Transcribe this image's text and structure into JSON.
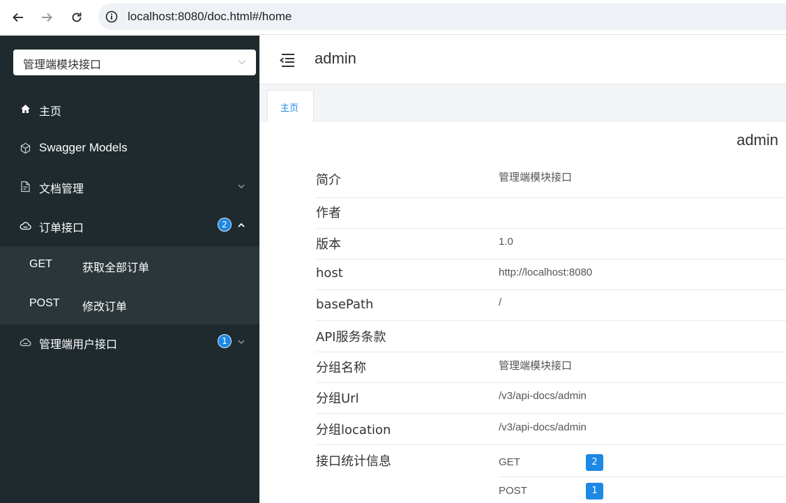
{
  "browser": {
    "url": "localhost:8080/doc.html#/home",
    "icons": [
      "back-arrow-icon",
      "forward-arrow-icon",
      "reload-icon",
      "info-icon"
    ]
  },
  "sidebar": {
    "group_select": "管理端模块接口",
    "items": [
      {
        "label": "主页",
        "icon": "home-icon"
      },
      {
        "label": "Swagger Models",
        "icon": "cube-icon"
      },
      {
        "label": "文档管理",
        "icon": "document-icon"
      },
      {
        "label": "订单接口",
        "icon": "cloud-icon",
        "badge": "2",
        "expanded": true
      },
      {
        "label": "管理端用户接口",
        "icon": "cloud-icon",
        "badge": "1",
        "expanded": false
      }
    ],
    "submenu": [
      {
        "method": "GET",
        "label": "获取全部订单"
      },
      {
        "method": "POST",
        "label": "修改订单"
      }
    ]
  },
  "main": {
    "title": "admin",
    "tab": "主页",
    "doc_title": "admin",
    "info": [
      {
        "label": "简介",
        "value": "管理端模块接口"
      },
      {
        "label": "作者",
        "value": ""
      },
      {
        "label": "版本",
        "value": "1.0"
      },
      {
        "label": "host",
        "value": "http://localhost:8080"
      },
      {
        "label": "basePath",
        "value": "/"
      },
      {
        "label": "API服务条款",
        "value": ""
      },
      {
        "label": "分组名称",
        "value": "管理端模块接口"
      },
      {
        "label": "分组Url",
        "value": "/v3/api-docs/admin"
      },
      {
        "label": "分组location",
        "value": "/v3/api-docs/admin"
      }
    ],
    "stats_label": "接口统计信息",
    "stats": [
      {
        "method": "GET",
        "count": "2"
      },
      {
        "method": "POST",
        "count": "1"
      }
    ]
  },
  "colors": {
    "sidebar_bg": "#1e2a2d",
    "submenu_bg": "#2a3639",
    "accent": "#1e88e5"
  }
}
